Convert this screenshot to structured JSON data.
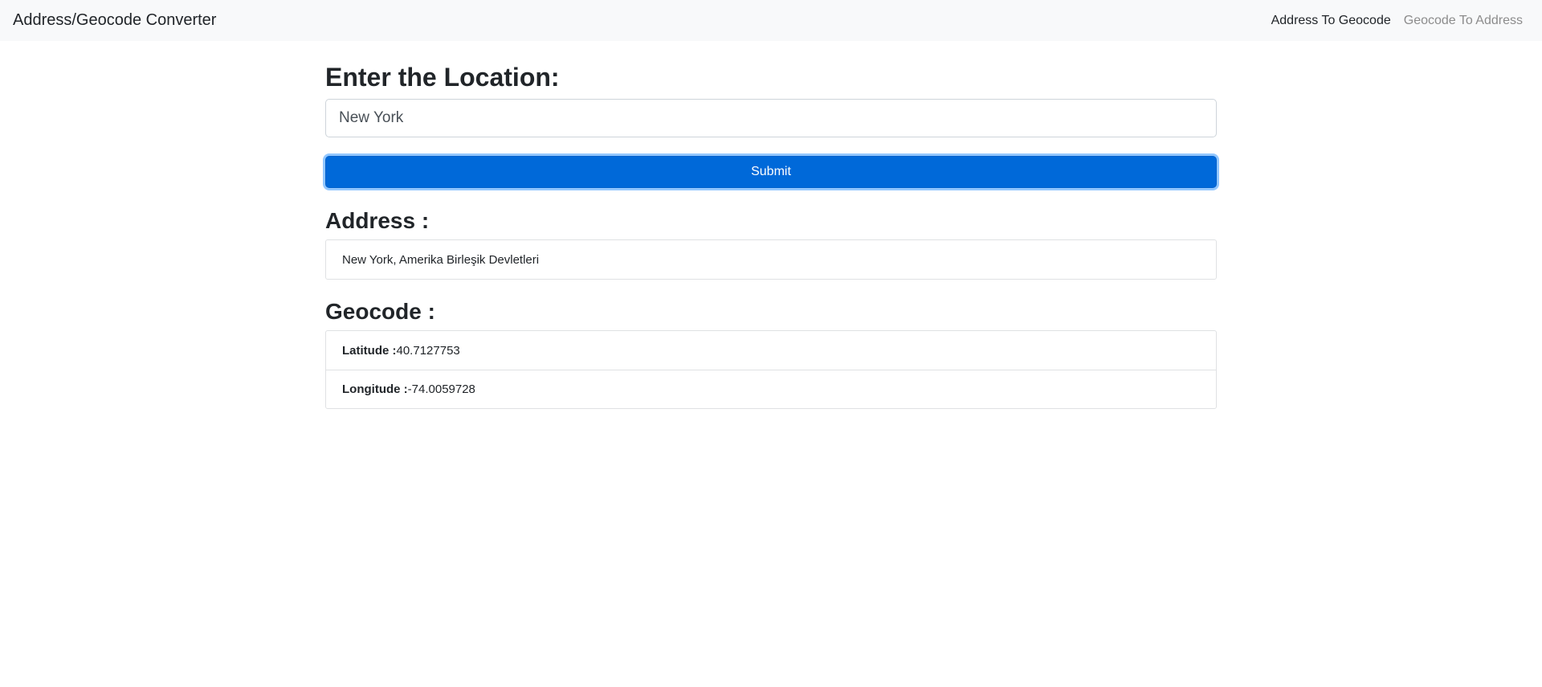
{
  "navbar": {
    "brand": "Address/Geocode Converter",
    "links": [
      {
        "label": "Address To Geocode",
        "active": true
      },
      {
        "label": "Geocode To Address",
        "active": false
      }
    ]
  },
  "form": {
    "title": "Enter the Location:",
    "input_value": "New York",
    "submit_label": "Submit"
  },
  "address": {
    "title": "Address :",
    "value": "New York, Amerika Birleşik Devletleri"
  },
  "geocode": {
    "title": "Geocode :",
    "latitude_label": "Latitude :",
    "latitude_value": "40.7127753",
    "longitude_label": "Longitude :",
    "longitude_value": "-74.0059728"
  },
  "colors": {
    "primary": "#0069d9",
    "navbar_bg": "#f8f9fa"
  }
}
